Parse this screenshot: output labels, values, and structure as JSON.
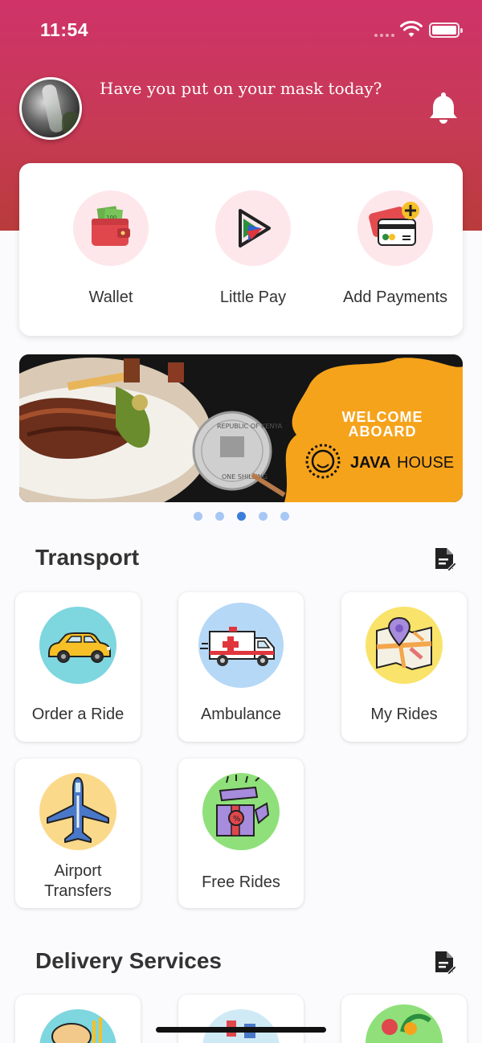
{
  "status_bar": {
    "time": "11:54"
  },
  "header": {
    "greeting": "Have you put on your mask today?"
  },
  "payments": [
    {
      "label": "Wallet",
      "icon": "wallet-icon"
    },
    {
      "label": "Little Pay",
      "icon": "little-pay-icon"
    },
    {
      "label": "Add Payments",
      "icon": "add-payment-card-icon"
    }
  ],
  "banner": {
    "headline_1": "WELCOME",
    "headline_2": "ABOARD",
    "brand_1": "JAVA",
    "brand_2": "HOUSE",
    "coin_top": "REPUBLIC OF KENYA",
    "coin_bottom": "ONE SHILLING",
    "slides_total": 5,
    "active_slide": 3
  },
  "transport": {
    "title": "Transport",
    "items": [
      {
        "label": "Order a Ride",
        "icon": "taxi-car-icon",
        "bg": "#7ed6df"
      },
      {
        "label": "Ambulance",
        "icon": "ambulance-icon",
        "bg": "#b5d8f7"
      },
      {
        "label": "My Rides",
        "icon": "map-pin-icon",
        "bg": "#f9e36a"
      },
      {
        "label_1": "Airport",
        "label_2": "Transfers",
        "icon": "airplane-icon",
        "bg": "#fbd98a"
      },
      {
        "label": "Free Rides",
        "icon": "gift-box-icon",
        "bg": "#8fe07a"
      }
    ]
  },
  "delivery": {
    "title": "Delivery Services"
  },
  "colors": {
    "header_top": "#cf3369",
    "header_bottom": "#b93b3b",
    "banner_orange": "#f6a31c",
    "dot_active": "#3b7ed9"
  }
}
